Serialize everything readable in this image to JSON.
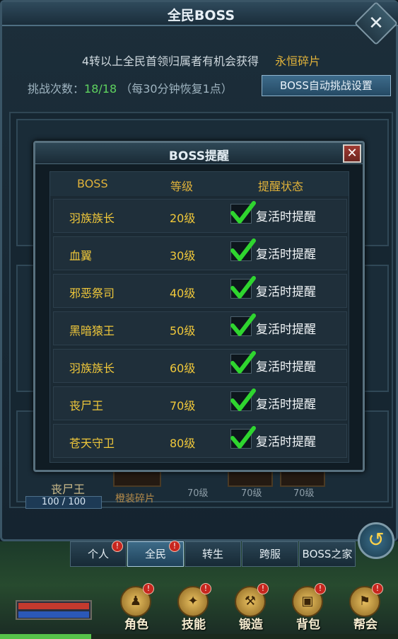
{
  "window": {
    "title": "全民BOSS",
    "close_label": "✕"
  },
  "info": {
    "text": "4转以上全民首领归属者有机会获得",
    "reward": "永恒碎片",
    "challenge_label": "挑战次数：",
    "challenge_count": "18/18",
    "challenge_note": "（每30分钟恢复1点）",
    "auto_button": "BOSS自动挑战设置"
  },
  "background": {
    "boss_name": "丧尸王",
    "hp": "100 / 100",
    "item_label": "橙装碎片",
    "levels": [
      "70级",
      "70级",
      "70级"
    ]
  },
  "popup": {
    "title": "BOSS提醒",
    "close_label": "✕",
    "headers": {
      "boss": "BOSS",
      "level": "等级",
      "status": "提醒状态"
    },
    "rows": [
      {
        "name": "羽族族长",
        "level": "20级",
        "status": "复活时提醒",
        "checked": true
      },
      {
        "name": "血翼",
        "level": "30级",
        "status": "复活时提醒",
        "checked": true
      },
      {
        "name": "邪恶祭司",
        "level": "40级",
        "status": "复活时提醒",
        "checked": true
      },
      {
        "name": "黑暗猿王",
        "level": "50级",
        "status": "复活时提醒",
        "checked": true
      },
      {
        "name": "羽族族长",
        "level": "60级",
        "status": "复活时提醒",
        "checked": true
      },
      {
        "name": "丧尸王",
        "level": "70级",
        "status": "复活时提醒",
        "checked": true
      },
      {
        "name": "苍天守卫",
        "level": "80级",
        "status": "复活时提醒",
        "checked": true
      }
    ]
  },
  "tabs": [
    {
      "label": "个人",
      "badge": "!"
    },
    {
      "label": "全民",
      "badge": "!"
    },
    {
      "label": "转生",
      "badge": ""
    },
    {
      "label": "跨服",
      "badge": ""
    },
    {
      "label": "BOSS之家",
      "badge": ""
    }
  ],
  "bottom_menu": [
    {
      "label": "角色",
      "icon": "character-icon",
      "badge": "!"
    },
    {
      "label": "技能",
      "icon": "skill-icon",
      "badge": "!"
    },
    {
      "label": "锻造",
      "icon": "anvil-icon",
      "badge": "!"
    },
    {
      "label": "背包",
      "icon": "bag-icon",
      "badge": "!"
    },
    {
      "label": "帮会",
      "icon": "guild-icon",
      "badge": "!"
    }
  ],
  "hud": {
    "exp_fill": 0.23
  },
  "colors": {
    "accent_gold": "#e0b23a",
    "count_green": "#5fd35f",
    "check_green": "#2fd52f"
  }
}
